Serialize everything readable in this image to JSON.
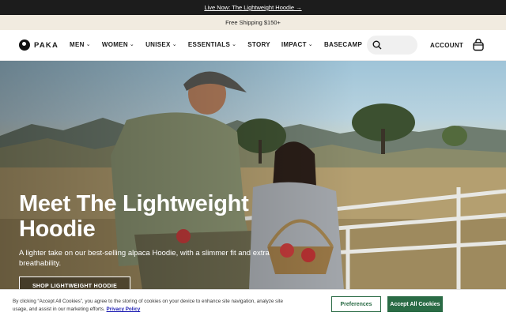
{
  "announcement": {
    "text": "Live Now: The Lightweight Hoodie →"
  },
  "shipping": {
    "text": "Free Shipping $150+"
  },
  "header": {
    "brand": "PAKA",
    "nav": [
      {
        "label": "MEN",
        "has_dropdown": true
      },
      {
        "label": "WOMEN",
        "has_dropdown": true
      },
      {
        "label": "UNISEX",
        "has_dropdown": true
      },
      {
        "label": "ESSENTIALS",
        "has_dropdown": true
      },
      {
        "label": "STORY",
        "has_dropdown": false
      },
      {
        "label": "IMPACT",
        "has_dropdown": true
      },
      {
        "label": "BASECAMP",
        "has_dropdown": false
      }
    ],
    "account": "ACCOUNT",
    "icons": {
      "search": "search-icon",
      "cart": "cart-icon",
      "logo": "paka-logo-icon"
    }
  },
  "hero": {
    "title": "Meet The Lightweight Hoodie",
    "subtitle": "A lighter take on our best-selling alpaca Hoodie, with a slimmer fit and extra breathability.",
    "cta": "SHOP LIGHTWEIGHT HOODIE",
    "image_alt": "Two people sitting on a white ranch fence in the countryside holding apples"
  },
  "cookie": {
    "text": "By clicking “Accept All Cookies”, you agree to the storing of cookies on your device to enhance site navigation, analyze site usage, and assist in our marketing efforts.",
    "policy_link": "Privacy Policy",
    "preferences": "Preferences",
    "accept": "Accept All Cookies"
  },
  "colors": {
    "announcement_bg": "#1c1c1c",
    "shipping_bg": "#f1ebe0",
    "cookie_accent": "#2a6b45"
  }
}
